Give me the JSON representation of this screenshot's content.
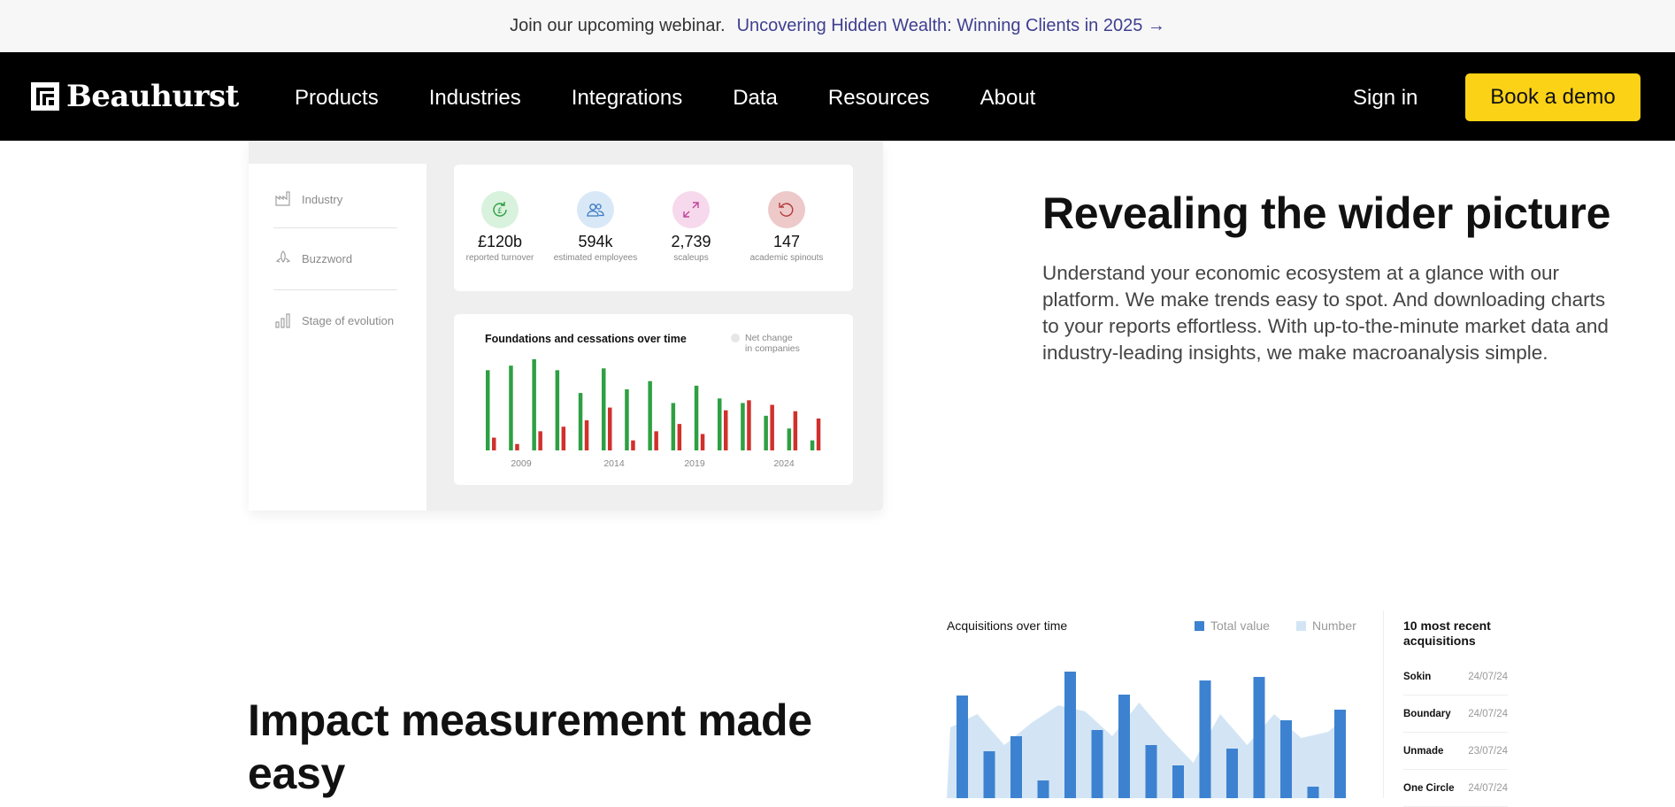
{
  "announcement": {
    "lead": "Join our upcoming webinar.",
    "link": "Uncovering Hidden Wealth: Winning Clients in 2025 →"
  },
  "nav": {
    "logo": "Beauhurst",
    "items": [
      "Products",
      "Industries",
      "Integrations",
      "Data",
      "Resources",
      "About"
    ],
    "signin": "Sign in",
    "demo": "Book a demo"
  },
  "dashboard": {
    "sidebar": [
      {
        "label": "Industry",
        "icon": "factory-icon"
      },
      {
        "label": "Buzzword",
        "icon": "rocket-icon"
      },
      {
        "label": "Stage of evolution",
        "icon": "growth-bars-icon"
      }
    ],
    "stats": [
      {
        "value": "£120b",
        "label": "reported turnover",
        "icon": "pound-cycle-icon",
        "bg": "#d9f2dd",
        "fg": "#2e9e45"
      },
      {
        "value": "594k",
        "label": "estimated employees",
        "icon": "people-icon",
        "bg": "#d9e8f7",
        "fg": "#3a7ac4"
      },
      {
        "value": "2,739",
        "label": "scaleups",
        "icon": "expand-arrows-icon",
        "bg": "#f6d9ec",
        "fg": "#c0459a"
      },
      {
        "value": "147",
        "label": "academic spinouts",
        "icon": "refresh-icon",
        "bg": "#eec9c9",
        "fg": "#b33a3a"
      }
    ]
  },
  "chart_data": [
    {
      "type": "bar",
      "title": "Foundations and cessations over time",
      "legend": [
        "Net change",
        "in companies"
      ],
      "x_tick_labels": [
        "2009",
        "2014",
        "2019",
        "2024"
      ],
      "series": [
        {
          "color": "#2ea043",
          "values": [
            8.8,
            9.3,
            10,
            8.8,
            6.3,
            9,
            6.7,
            7.6,
            5.2,
            7.1,
            5.7,
            5.2,
            3.8,
            2.4,
            1.1
          ]
        },
        {
          "color": "#d0312d",
          "values": [
            1.4,
            0.7,
            2.1,
            2.6,
            3.3,
            4.7,
            1.1,
            2.1,
            2.9,
            1.8,
            4.4,
            5.5,
            5,
            4.3,
            3.5
          ]
        }
      ]
    },
    {
      "type": "bar",
      "title": "Acquisitions over time",
      "series": [
        {
          "name": "Total value",
          "color": "#3d82d1",
          "values": [
            116,
            53,
            70,
            20,
            143,
            77,
            117,
            60,
            37,
            133,
            56,
            137,
            88,
            13,
            100
          ]
        },
        {
          "name": "Number",
          "color": "#d3e5f5",
          "values": [
            80,
            95,
            60,
            85,
            105,
            98,
            70,
            108,
            72,
            40,
            95,
            60,
            95,
            68,
            75
          ]
        }
      ]
    }
  ],
  "hero": {
    "heading": "Revealing the wider picture",
    "body": "Understand your economic ecosystem at a glance with our platform. We make trends easy to spot. And downloading charts to your reports effortless. With up-to-the-minute market data and industry-leading insights, we make macroanalysis simple."
  },
  "impact": {
    "heading": "Impact measurement made easy"
  },
  "recent": {
    "title": "10 most recent acquisitions",
    "rows": [
      {
        "name": "Sokin",
        "date": "24/07/24"
      },
      {
        "name": "Boundary",
        "date": "24/07/24"
      },
      {
        "name": "Unmade",
        "date": "23/07/24"
      },
      {
        "name": "One Circle",
        "date": "24/07/24"
      }
    ]
  }
}
